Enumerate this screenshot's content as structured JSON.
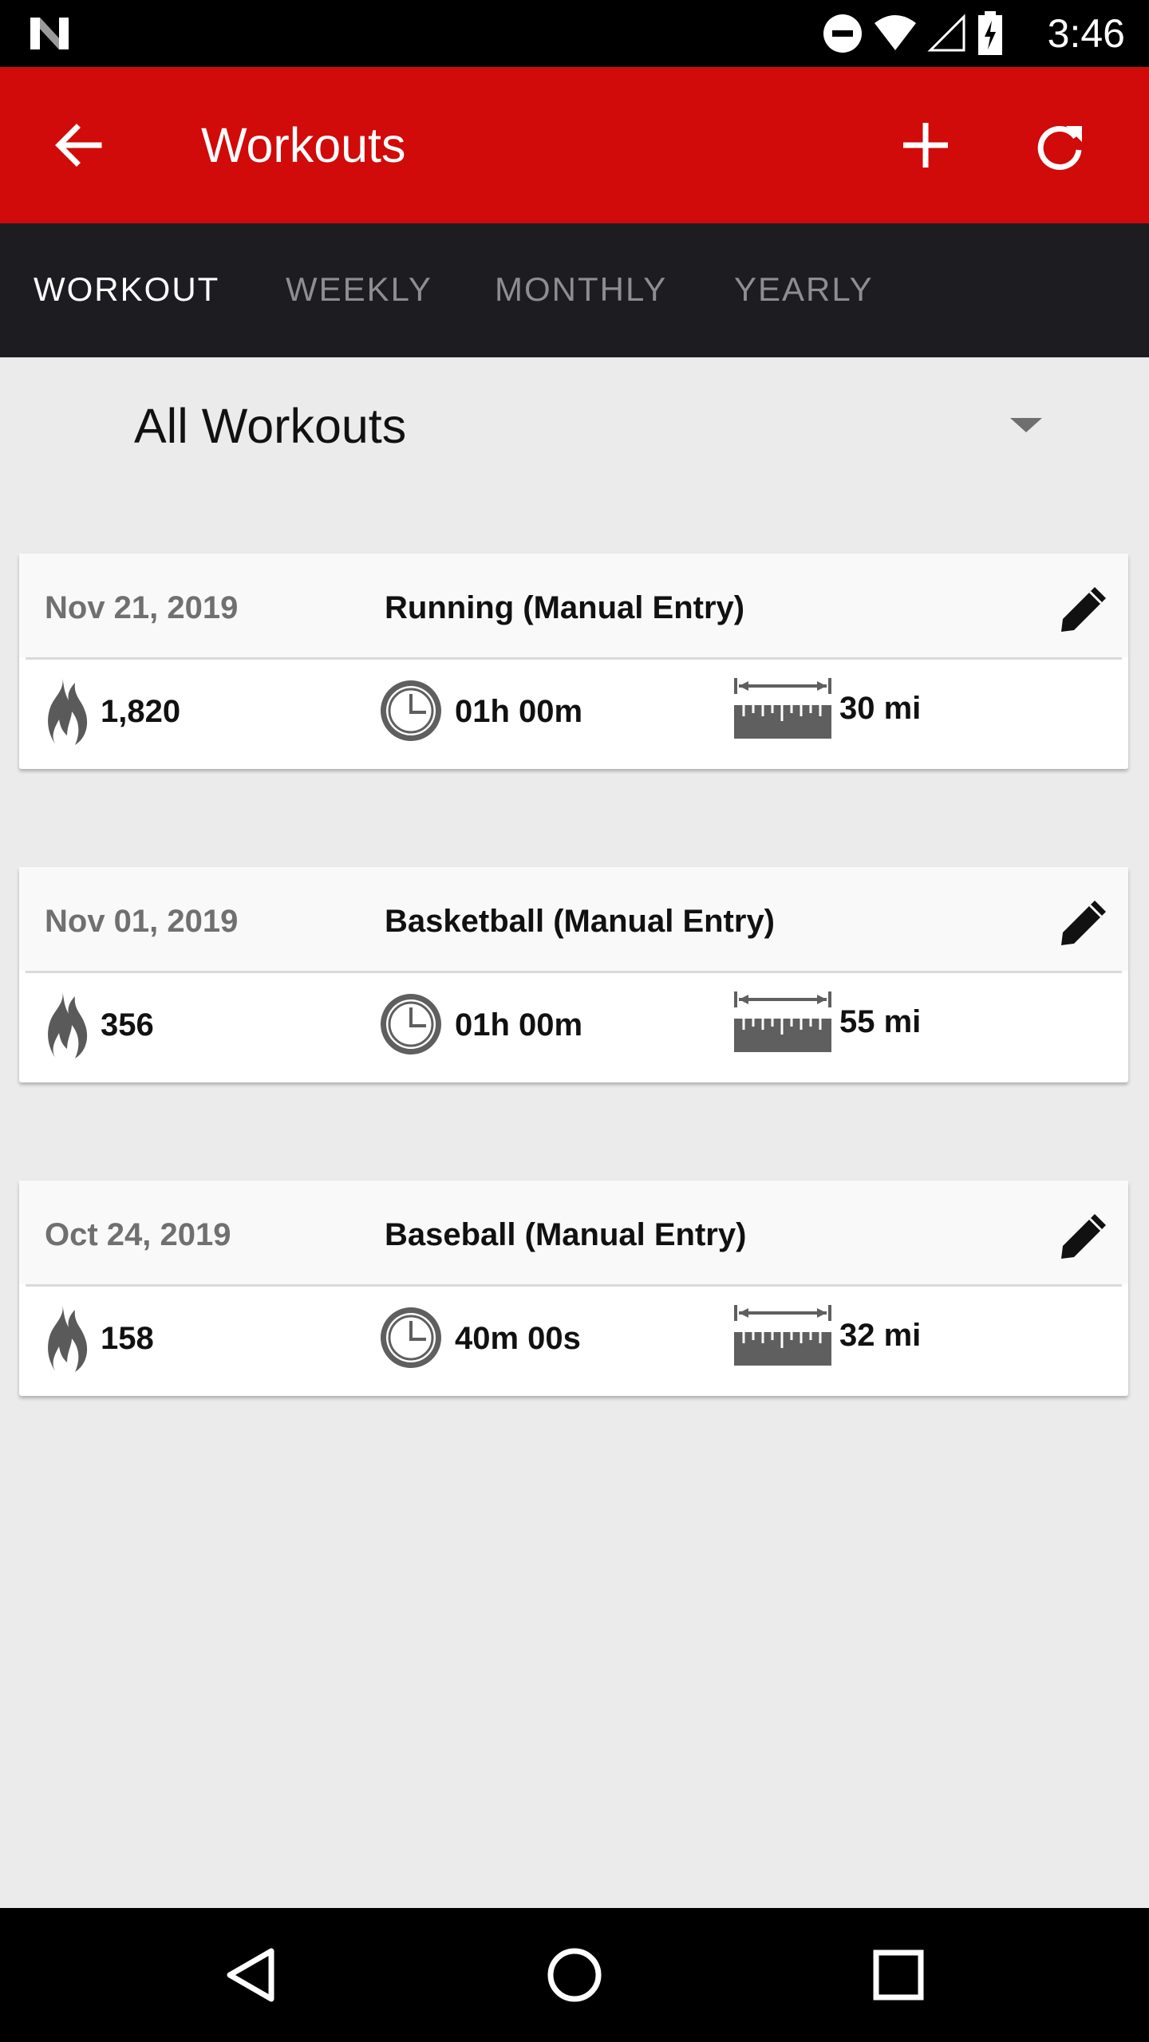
{
  "status_bar": {
    "time": "3:46",
    "icons": [
      "n-logo-icon",
      "do-not-disturb-icon",
      "wifi-icon",
      "signal-icon",
      "battery-charging-icon"
    ]
  },
  "app_bar": {
    "title": "Workouts",
    "background": "#d10a0a",
    "icons": [
      "back-arrow-icon",
      "add-icon",
      "refresh-icon"
    ]
  },
  "tabs": [
    {
      "label": "WORKOUT",
      "active": true
    },
    {
      "label": "WEEKLY",
      "active": false
    },
    {
      "label": "MONTHLY",
      "active": false
    },
    {
      "label": "YEARLY",
      "active": false
    }
  ],
  "filter": {
    "selected": "All Workouts"
  },
  "workouts": [
    {
      "date": "Nov 21, 2019",
      "name": "Running (Manual Entry)",
      "calories": "1,820",
      "duration": "01h 00m",
      "distance": "30 mi"
    },
    {
      "date": "Nov 01, 2019",
      "name": "Basketball (Manual Entry)",
      "calories": "356",
      "duration": "01h 00m",
      "distance": "55 mi"
    },
    {
      "date": "Oct 24, 2019",
      "name": "Baseball (Manual Entry)",
      "calories": "158",
      "duration": "40m 00s",
      "distance": "32 mi"
    }
  ],
  "nav_bar": {
    "icons": [
      "back-triangle-icon",
      "home-circle-icon",
      "recents-square-icon"
    ]
  }
}
